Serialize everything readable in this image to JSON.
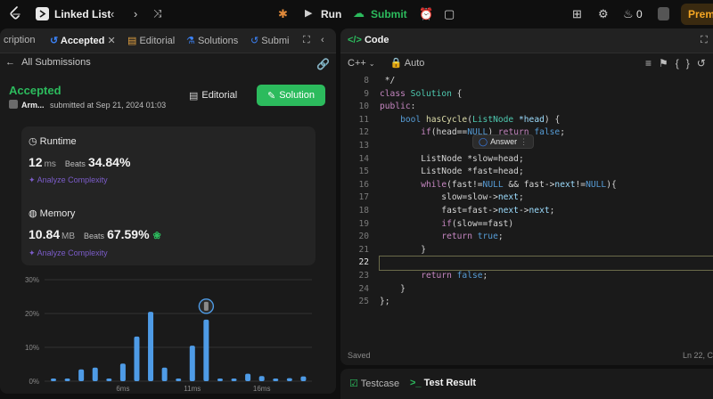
{
  "topbar": {
    "problem_list_title": "Linked List",
    "run_label": "Run",
    "submit_label": "Submit",
    "streak_count": "0",
    "premium_label": "Premi"
  },
  "left": {
    "tabs": [
      "cription",
      "Accepted",
      "Editorial",
      "Solutions",
      "Submi"
    ],
    "back_label": "All Submissions",
    "status": "Accepted",
    "author": "Arm...",
    "submitted_text": "submitted at Sep 21, 2024 01:03",
    "editorial_label": "Editorial",
    "solution_label": "Solution",
    "runtime": {
      "title": "Runtime",
      "value": "12",
      "unit": "ms",
      "beats_label": "Beats",
      "beats": "34.84%",
      "analyze": "Analyze Complexity"
    },
    "memory": {
      "title": "Memory",
      "value": "10.84",
      "unit": "MB",
      "beats_label": "Beats",
      "beats": "67.59%",
      "analyze": "Analyze Complexity"
    }
  },
  "chart_data": {
    "type": "bar",
    "y_ticks": [
      "30%",
      "20%",
      "10%",
      "0%"
    ],
    "ylim": [
      0,
      30
    ],
    "x_ticks": [
      "6ms",
      "11ms",
      "16ms"
    ],
    "values": [
      0.8,
      0.8,
      3.5,
      4,
      0.8,
      5.2,
      13.2,
      20.5,
      4,
      0.8,
      10.5,
      18.2,
      0.8,
      0.8,
      2.2,
      1.5,
      0.8,
      0.9,
      1.4
    ],
    "highlight_index": 11,
    "bar_color": "#4e9be6",
    "grid": true
  },
  "editor": {
    "tab_label": "Code",
    "language": "C++",
    "mode": "Auto",
    "answer_label": "Answer",
    "status": "Saved",
    "cursor": "Ln 22, C",
    "current_line": 22,
    "line_numbers": [
      "8",
      "9",
      "10",
      "11",
      "12",
      "13",
      "14",
      "15",
      "16",
      "17",
      "18",
      "19",
      "20",
      "21",
      "22",
      "23",
      "24",
      "25"
    ]
  },
  "bottom": {
    "testcase_label": "Testcase",
    "test_result_label": "Test Result"
  },
  "colors": {
    "accent_green": "#2cbb5d",
    "premium_orange": "#f5a623",
    "analyze_purple": "#7b5cc9"
  }
}
